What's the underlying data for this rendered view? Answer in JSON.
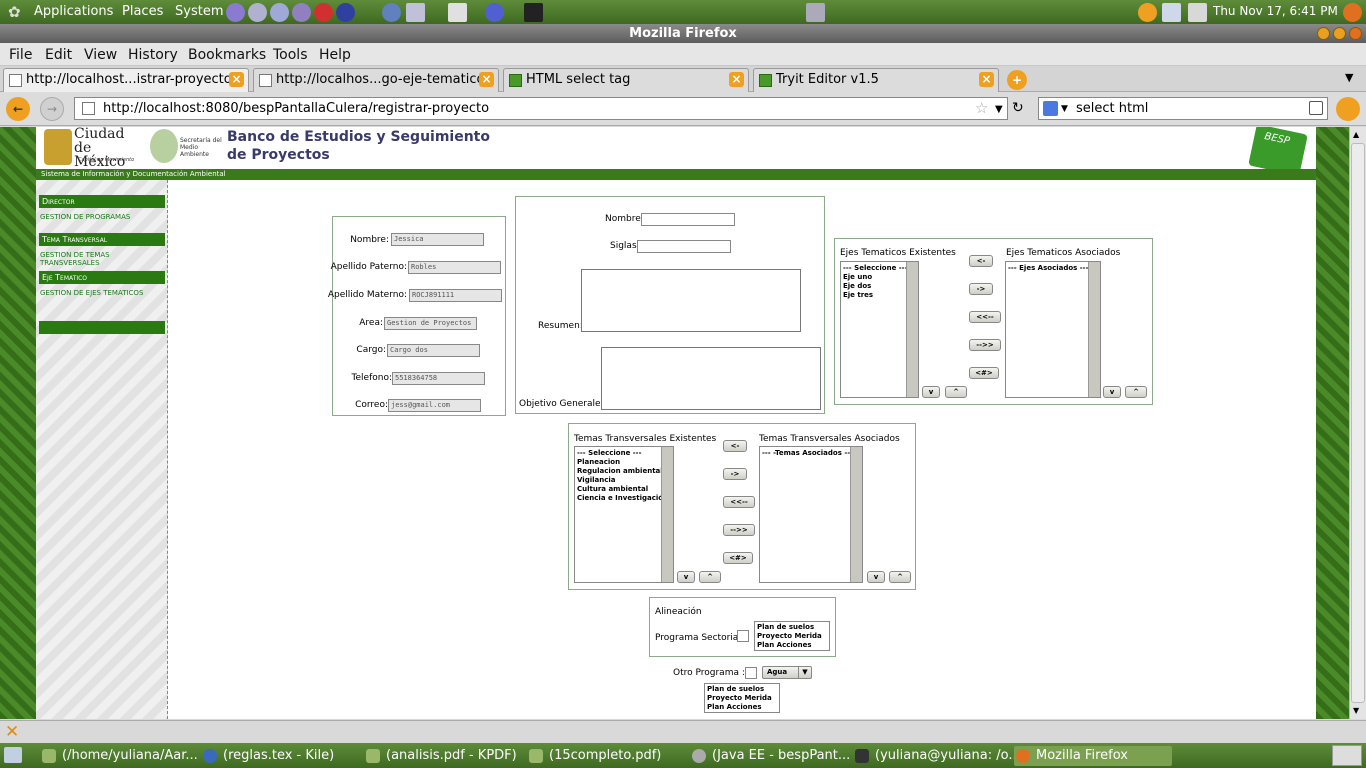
{
  "panel": {
    "applications": "Applications",
    "places": "Places",
    "system": "System",
    "clock": "Thu Nov 17,  6:41 PM"
  },
  "window": {
    "title": "Mozilla Firefox"
  },
  "menu": {
    "file": "File",
    "edit": "Edit",
    "view": "View",
    "history": "History",
    "bookmarks": "Bookmarks",
    "tools": "Tools",
    "help": "Help"
  },
  "tabs": [
    {
      "label": "http://localhost...istrar-proyecto"
    },
    {
      "label": "http://localhos...go-eje-tematico"
    },
    {
      "label": "HTML select tag"
    },
    {
      "label": "Tryit Editor v1.5"
    }
  ],
  "nav": {
    "url": "http://localhost:8080/bespPantallaCulera/registrar-proyecto",
    "search": "select html"
  },
  "site": {
    "logo_text": "Ciudad de México",
    "logo_sub": "Capital en Movimiento",
    "secretaria": "Secretaría del Medio Ambiente",
    "title": "Banco de Estudios y Seguimiento de Proyectos",
    "subtitle": "Sistema de Información y Documentación Ambiental",
    "besp": "BESP"
  },
  "sidebar": {
    "director": "Director",
    "gestion_programas": "Gestion de Programas",
    "tema_transversal": "Tema Transversal",
    "gestion_temas": "Gestion de Temas Transversales",
    "eje_tematico": "Eje Tematico",
    "gestion_ejes": "Gestion de Ejes Tematicos"
  },
  "persona": {
    "nombre_label": "Nombre:",
    "nombre": "Jessica",
    "ap_label": "Apellido Paterno:",
    "ap": "Robles",
    "am_label": "Apellido Materno:",
    "am": "ROCJ891111",
    "area_label": "Area:",
    "area": "Gestion de Proyectos",
    "cargo_label": "Cargo:",
    "cargo": "Cargo dos",
    "tel_label": "Telefono:",
    "tel": "5518364758",
    "correo_label": "Correo:",
    "correo": "jess@gmail.com"
  },
  "proyecto": {
    "nombre_label": "Nombre:",
    "siglas_label": "Siglas:",
    "resumen_label": "Resumen:",
    "objetivo_label": "Objetivo Generales:"
  },
  "ejes": {
    "existentes_label": "Ejes Tematicos Existentes",
    "asociados_label": "Ejes Tematicos Asociados",
    "existentes": [
      "--- Seleccione ---",
      "Eje uno",
      "Eje dos",
      "Eje tres"
    ],
    "asociados": [
      "--- Ejes Asociados ---"
    ]
  },
  "temas": {
    "existentes_label": "Temas Transversales Existentes",
    "asociados_label": "Temas Transversales Asociados",
    "existentes": [
      "--- Seleccione ---",
      "Planeacion",
      "Regulacion ambiental",
      "Vigilancia",
      "Cultura ambiental",
      "Ciencia e Investigación"
    ],
    "asociados": [
      "--- -Temas Asociados ---"
    ]
  },
  "buttons": {
    "left": "<-",
    "right": "->",
    "all_left": "<<--",
    "all_right": "-->>",
    "swap": "<#>",
    "down": "v",
    "up": "^"
  },
  "alineacion": {
    "title": "Alineación",
    "programa_label": "Programa Sectorial",
    "programas": [
      "Plan de suelos",
      "Proyecto Merida",
      "Plan Acciones"
    ],
    "otro_label": "Otro Programa :",
    "otro_select": "Agua",
    "otros": [
      "Plan de suelos",
      "Proyecto Merida",
      "Plan Acciones"
    ]
  },
  "taskbar": [
    {
      "label": "(/home/yuliana/Aar..."
    },
    {
      "label": "(reglas.tex - Kile)"
    },
    {
      "label": "(analisis.pdf - KPDF)"
    },
    {
      "label": "(15completo.pdf)"
    },
    {
      "label": "(Java EE - bespPant..."
    },
    {
      "label": "(yuliana@yuliana: /o..."
    },
    {
      "label": "Mozilla Firefox"
    }
  ]
}
